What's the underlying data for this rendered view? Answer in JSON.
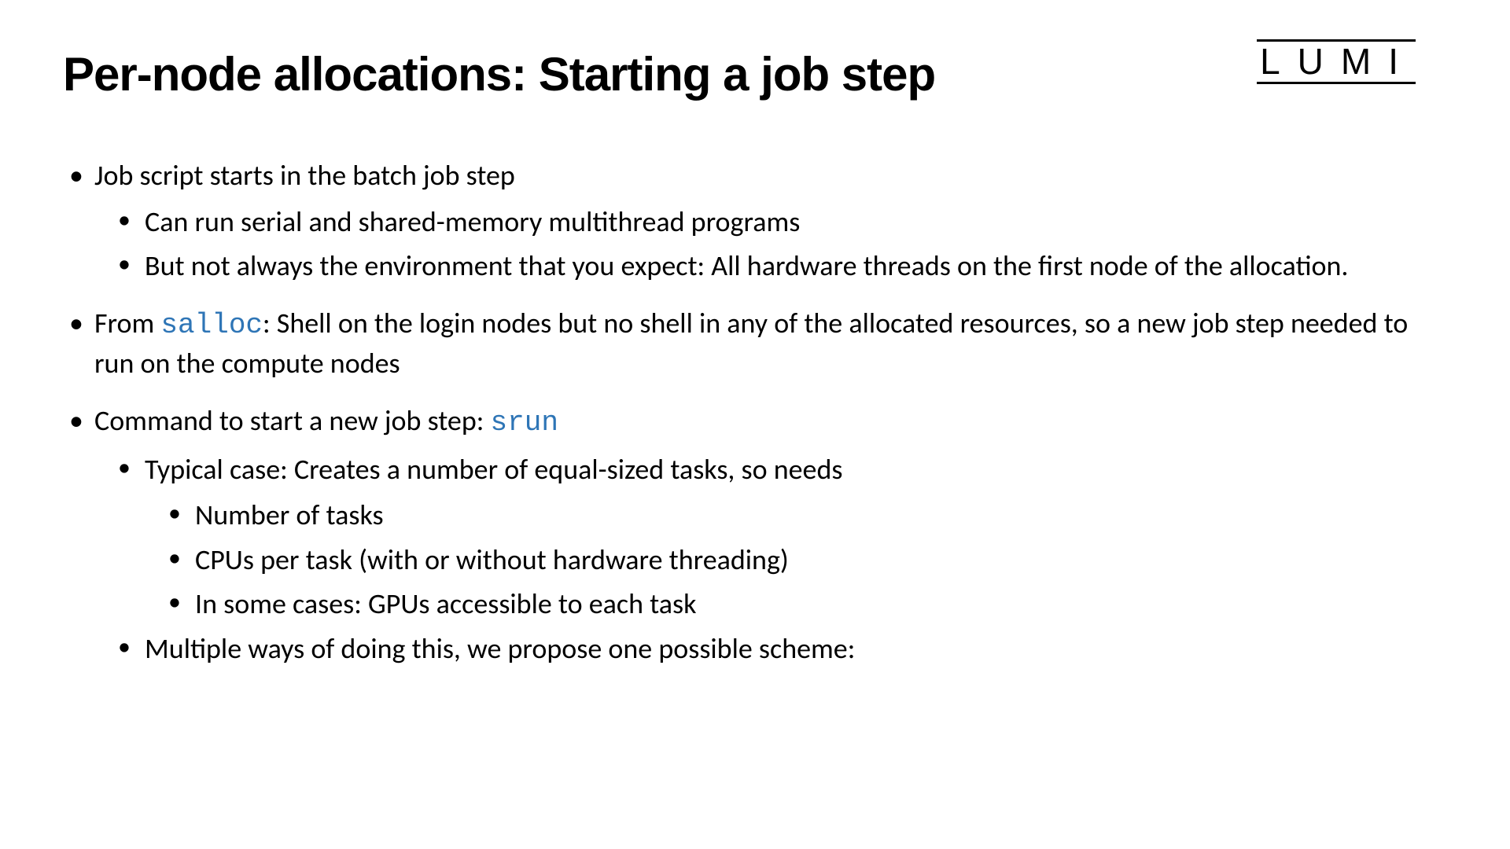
{
  "title": "Per-node allocations: Starting a job step",
  "logo": "LUMI",
  "bullets": {
    "item1": "Job script starts in the batch job step",
    "item1_sub1": "Can run serial and shared-memory multithread programs",
    "item1_sub2": "But not always the environment that you expect: All hardware threads on the first node of the allocation.",
    "item2_pre": "From ",
    "item2_code": "salloc",
    "item2_post": ": Shell on the login nodes but no shell in any of the allocated resources, so a new job step needed to run on the compute nodes",
    "item3_pre": "Command to start a new job step: ",
    "item3_code": "srun",
    "item3_sub1": "Typical case: Creates a number of equal-sized tasks, so needs",
    "item3_sub1_sub1": "Number of tasks",
    "item3_sub1_sub2": "CPUs per task (with or without hardware threading)",
    "item3_sub1_sub3": "In some cases: GPUs accessible to each task",
    "item3_sub2": "Multiple ways of doing this, we propose one possible scheme:"
  }
}
